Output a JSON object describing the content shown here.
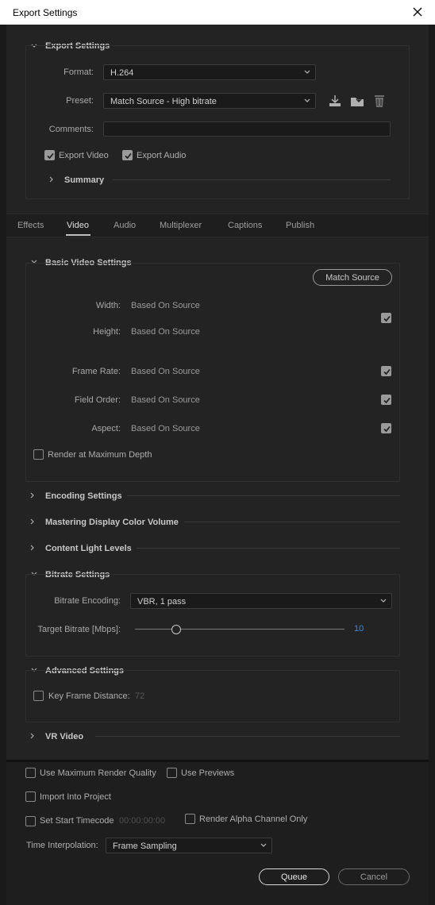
{
  "window": {
    "title": "Export Settings"
  },
  "export_settings": {
    "heading": "Export Settings",
    "format_label": "Format:",
    "format_value": "H.264",
    "preset_label": "Preset:",
    "preset_value": "Match Source - High bitrate",
    "comments_label": "Comments:",
    "comments_value": "",
    "export_video_label": "Export Video",
    "export_audio_label": "Export Audio",
    "summary_label": "Summary"
  },
  "tabs": [
    "Effects",
    "Video",
    "Audio",
    "Multiplexer",
    "Captions",
    "Publish"
  ],
  "basic_video": {
    "heading": "Basic Video Settings",
    "match_source_label": "Match Source",
    "width_label": "Width:",
    "width_value": "Based On Source",
    "height_label": "Height:",
    "height_value": "Based On Source",
    "frame_rate_label": "Frame Rate:",
    "frame_rate_value": "Based On Source",
    "field_order_label": "Field Order:",
    "field_order_value": "Based On Source",
    "aspect_label": "Aspect:",
    "aspect_value": "Based On Source",
    "render_max_depth_label": "Render at Maximum Depth"
  },
  "collapsed_sections": {
    "encoding": "Encoding Settings",
    "mastering": "Mastering Display Color Volume",
    "content_light": "Content Light Levels",
    "vr_video": "VR Video"
  },
  "bitrate": {
    "heading": "Bitrate Settings",
    "encoding_label": "Bitrate Encoding:",
    "encoding_value": "VBR, 1 pass",
    "target_label": "Target Bitrate [Mbps]:",
    "target_value": "10"
  },
  "advanced": {
    "heading": "Advanced Settings",
    "key_frame_label": "Key Frame Distance:",
    "key_frame_value": "72"
  },
  "bottom": {
    "max_render_quality_label": "Use Maximum Render Quality",
    "use_previews_label": "Use Previews",
    "import_into_project_label": "Import Into Project",
    "set_start_timecode_label": "Set Start Timecode",
    "start_timecode_value": "00:00:00:00",
    "render_alpha_label": "Render Alpha Channel Only",
    "time_interp_label": "Time Interpolation:",
    "time_interp_value": "Frame Sampling",
    "queue_label": "Queue",
    "cancel_label": "Cancel"
  }
}
